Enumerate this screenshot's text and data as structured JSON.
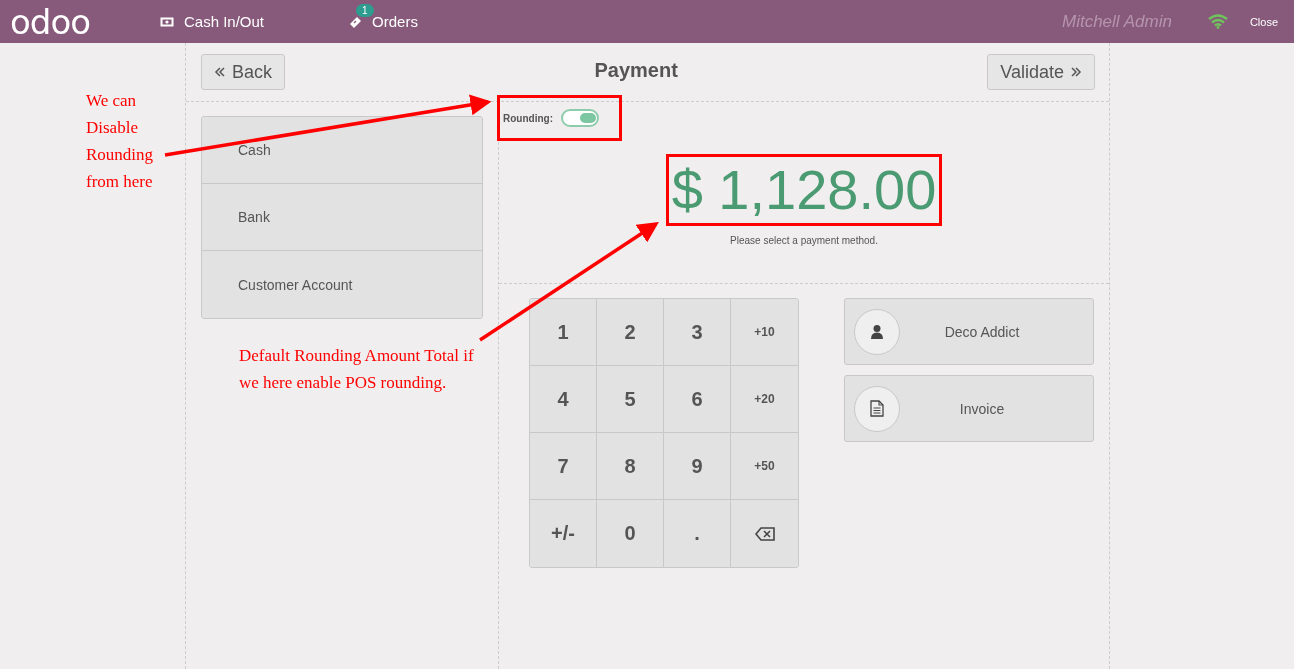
{
  "header": {
    "logo": "odoo",
    "cash_button": "Cash In/Out",
    "orders_button": "Orders",
    "orders_badge": "1",
    "user": "Mitchell Admin",
    "close": "Close"
  },
  "control": {
    "back": "Back",
    "title": "Payment",
    "validate": "Validate"
  },
  "payment_methods": [
    "Cash",
    "Bank",
    "Customer Account"
  ],
  "rounding": {
    "label": "Rounding:",
    "on": true
  },
  "amount": "$ 1,128.00",
  "hint": "Please select a payment method.",
  "numpad": [
    {
      "kind": "digit",
      "label": "1"
    },
    {
      "kind": "digit",
      "label": "2"
    },
    {
      "kind": "digit",
      "label": "3"
    },
    {
      "kind": "add",
      "label": "+10"
    },
    {
      "kind": "digit",
      "label": "4"
    },
    {
      "kind": "digit",
      "label": "5"
    },
    {
      "kind": "digit",
      "label": "6"
    },
    {
      "kind": "add",
      "label": "+20"
    },
    {
      "kind": "digit",
      "label": "7"
    },
    {
      "kind": "digit",
      "label": "8"
    },
    {
      "kind": "digit",
      "label": "9"
    },
    {
      "kind": "add",
      "label": "+50"
    },
    {
      "kind": "digit",
      "label": "+/-"
    },
    {
      "kind": "digit",
      "label": "0"
    },
    {
      "kind": "digit",
      "label": "."
    },
    {
      "kind": "backspace"
    }
  ],
  "side_buttons": [
    {
      "kind": "customer",
      "label": "Deco Addict"
    },
    {
      "kind": "invoice",
      "label": "Invoice"
    }
  ],
  "annotations": [
    "We can Disable Rounding from here",
    "Default Rounding Amount Total if we here enable POS rounding."
  ]
}
